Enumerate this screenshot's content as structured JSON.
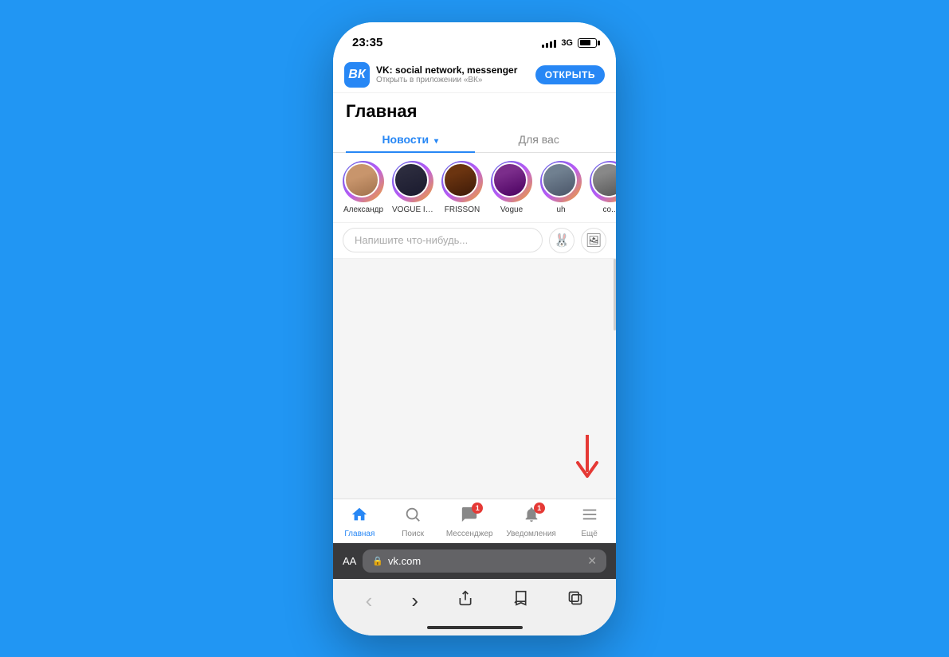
{
  "statusBar": {
    "time": "23:35",
    "network": "3G"
  },
  "appBanner": {
    "appName": "VK: social network, messenger",
    "subtitle": "Открыть в приложении «ВК»",
    "openButton": "ОТКРЫТЬ"
  },
  "page": {
    "title": "Главная"
  },
  "tabs": [
    {
      "label": "Новости",
      "active": true,
      "hasArrow": true
    },
    {
      "label": "Для вас",
      "active": false,
      "hasArrow": false
    }
  ],
  "stories": [
    {
      "id": "aleksandr",
      "label": "Александр"
    },
    {
      "id": "vogue",
      "label": "VOGUE IS ..."
    },
    {
      "id": "frisson",
      "label": "FRISSON"
    },
    {
      "id": "vogue2",
      "label": "Vogue"
    },
    {
      "id": "uh",
      "label": "uh"
    },
    {
      "id": "cut",
      "label": "co..."
    }
  ],
  "postInput": {
    "placeholder": "Напишите что-нибудь..."
  },
  "bottomNav": [
    {
      "id": "home",
      "label": "Главная",
      "icon": "🏠",
      "active": true,
      "badge": null
    },
    {
      "id": "search",
      "label": "Поиск",
      "icon": "🔍",
      "active": false,
      "badge": null
    },
    {
      "id": "messenger",
      "label": "Мессенджер",
      "icon": "💬",
      "active": false,
      "badge": "1"
    },
    {
      "id": "notifications",
      "label": "Уведомления",
      "icon": "🔔",
      "active": false,
      "badge": "1"
    },
    {
      "id": "more",
      "label": "Ещё",
      "icon": "☰",
      "active": false,
      "badge": null
    }
  ],
  "browserBar": {
    "aaLabel": "AA",
    "url": "vk.com",
    "lockIcon": "🔒"
  },
  "browserControls": {
    "back": "‹",
    "forward": "›",
    "share": "⬆",
    "bookmarks": "📖",
    "tabs": "⧉"
  }
}
